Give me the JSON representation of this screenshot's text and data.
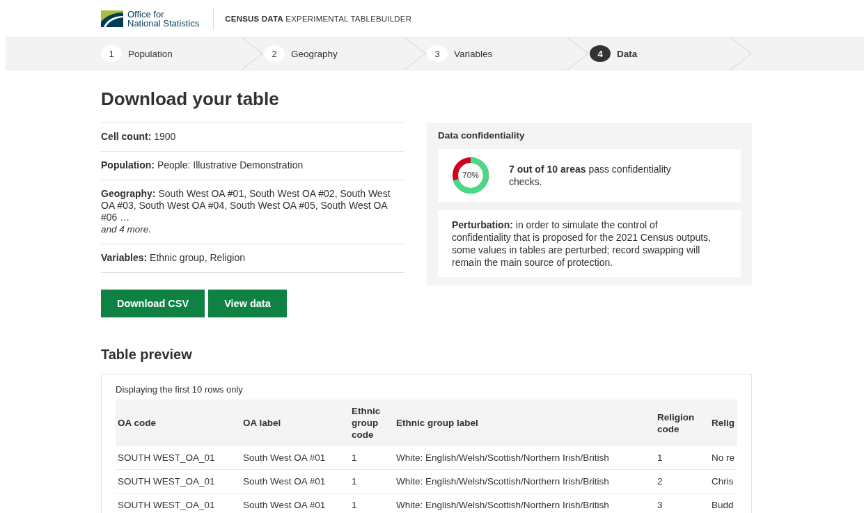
{
  "header": {
    "logo_lines": [
      "Office for",
      "National Statistics"
    ],
    "title_bold": "CENSUS DATA",
    "title_rest": "EXPERIMENTAL TABLEBUILDER"
  },
  "steps": [
    {
      "number": "1",
      "label": "Population",
      "selected": false
    },
    {
      "number": "2",
      "label": "Geography",
      "selected": false
    },
    {
      "number": "3",
      "label": "Variables",
      "selected": false
    },
    {
      "number": "4",
      "label": "Data",
      "selected": true
    }
  ],
  "heading": "Download your table",
  "summary": [
    {
      "text": "**Cell count:** 1900"
    },
    {
      "text": "**Population:** People: Illustrative Demonstration"
    },
    {
      "text": "**Geography:** South West OA #01, South West OA #02, South West OA #03, South West OA #04, South West OA #05, South West OA #06 …",
      "more": "and 4 more."
    },
    {
      "text": "**Variables:** Ethnic group, Religion"
    }
  ],
  "buttons": [
    "Download CSV",
    "View data"
  ],
  "confidentiality": {
    "title": "Data confidentiality",
    "level": 0.7,
    "percent": "70%",
    "message": "**7 out of 10 areas** pass confidentiality checks.",
    "note": "**Perturbation:** in order to simulate the control of confidentiality that is proposed for the 2021 Census outputs, some values in tables are perturbed; record swapping will remain the main source of protection."
  },
  "preview": {
    "title": "Table preview",
    "caption": "Displaying the first 10 rows only",
    "columns": [
      "OA code",
      "OA label",
      "Ethnic group code",
      "Ethnic group label",
      "Religion code",
      "Relig"
    ],
    "rows": [
      [
        "SOUTH WEST_OA_01",
        "South West OA #01",
        "1",
        "White: English/Welsh/Scottish/Northern Irish/British",
        "1",
        "No re"
      ],
      [
        "SOUTH WEST_OA_01",
        "South West OA #01",
        "1",
        "White: English/Welsh/Scottish/Northern Irish/British",
        "2",
        "Chris"
      ],
      [
        "SOUTH WEST_OA_01",
        "South West OA #01",
        "1",
        "White: English/Welsh/Scottish/Northern Irish/British",
        "3",
        "Budd"
      ]
    ]
  }
}
